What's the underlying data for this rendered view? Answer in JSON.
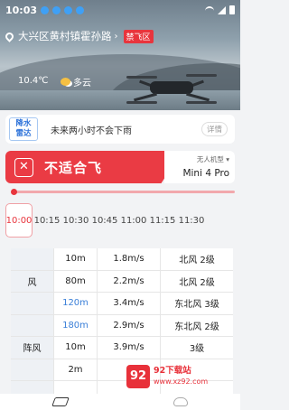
{
  "status_bar": {
    "time": "10:03"
  },
  "header": {
    "location": "大兴区黄村镇霍孙路",
    "no_fly_tag": "禁飞区",
    "temperature": "10.4℃",
    "weather": "多云"
  },
  "radar": {
    "badge_line1": "降水",
    "badge_line2": "雷达",
    "message": "未来两小时不会下雨",
    "detail_label": "详情"
  },
  "verdict": {
    "text": "不适合飞",
    "model_label": "无人机型",
    "model_name": "Mini 4 Pro",
    "color": "#ea3b44"
  },
  "time_slots": [
    "10:00",
    "10:15",
    "10:30",
    "10:45",
    "11:00",
    "11:15",
    "11:30"
  ],
  "selected_time_index": 0,
  "table": {
    "rows": [
      {
        "group": "",
        "height": "10m",
        "speed": "1.8m/s",
        "level": "北风 2级"
      },
      {
        "group": "风",
        "height": "80m",
        "speed": "2.2m/s",
        "level": "北风 2级"
      },
      {
        "group": "",
        "height": "120m",
        "speed": "3.4m/s",
        "level": "东北风 3级",
        "highlight": true
      },
      {
        "group": "",
        "height": "180m",
        "speed": "2.9m/s",
        "level": "东北风 2级",
        "highlight": true
      },
      {
        "group": "阵风",
        "height": "10m",
        "speed": "3.9m/s",
        "level": "3级"
      },
      {
        "group": "",
        "height": "2m",
        "speed": "",
        "level": ""
      },
      {
        "group": "",
        "height": "",
        "speed": "",
        "level": ""
      }
    ]
  },
  "watermark": {
    "logo": "92",
    "line1": "92下载站",
    "line2": "www.xz92.com"
  },
  "bottom_nav": {
    "items": [
      "layers-icon",
      "cloud-icon"
    ]
  }
}
